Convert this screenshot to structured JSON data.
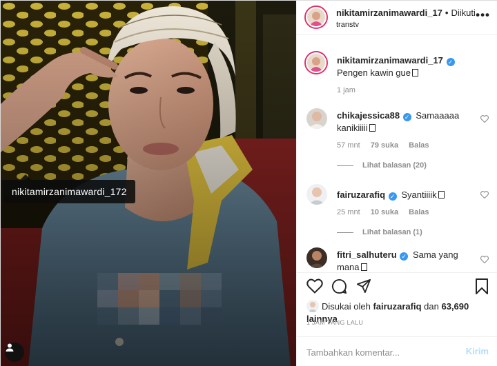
{
  "photo": {
    "tag_label": "nikitamirzanimawardi_172"
  },
  "header": {
    "username": "nikitamirzanimawardi_17",
    "separator": "•",
    "follow_label": "Diikuti",
    "location": "transtv",
    "more_icon": "more-horizontal-icon"
  },
  "caption": {
    "username": "nikitamirzanimawardi_17",
    "text": "Pengen kawin gue",
    "time": "1 jam"
  },
  "comments": [
    {
      "username": "chikajessica88",
      "text": "Samaaaaa kanikiiiii",
      "time": "57 mnt",
      "likes": "79 suka",
      "reply": "Balas",
      "view_replies": "Lihat balasan (20)"
    },
    {
      "username": "fairuzarafiq",
      "text": "Syantiiiik",
      "time": "25 mnt",
      "likes": "10 suka",
      "reply": "Balas",
      "view_replies": "Lihat balasan (1)"
    },
    {
      "username": "fitri_salhuteru",
      "text": "Sama yang mana"
    }
  ],
  "likes": {
    "prefix": "Disukai oleh",
    "user": "fairuzarafiq",
    "middle": "dan",
    "count": "63,690 lainnya"
  },
  "posted": "1 JAM YANG LALU",
  "add_comment": {
    "placeholder": "Tambahkan komentar...",
    "post_label": "Kirim"
  },
  "colors": {
    "verified": "#3897f0",
    "story_ring": "#e1306c",
    "post_disabled": "#b2dffc"
  }
}
